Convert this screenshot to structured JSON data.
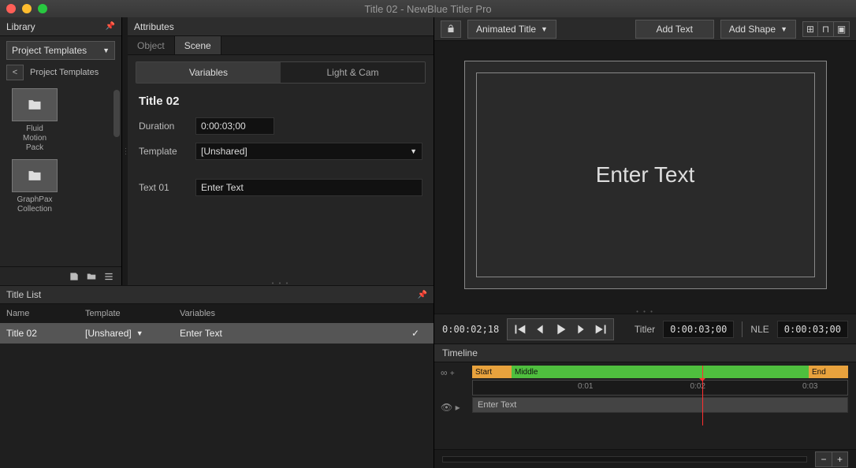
{
  "window": {
    "title": "Title 02 - NewBlue Titler Pro"
  },
  "library": {
    "header": "Library",
    "dropdown": "Project Templates",
    "breadcrumb": "Project Templates",
    "items": [
      {
        "label": "Fluid\nMotion\nPack"
      },
      {
        "label": "GraphPax\nCollection"
      }
    ]
  },
  "attributes": {
    "header": "Attributes",
    "tabs": {
      "object": "Object",
      "scene": "Scene"
    },
    "subtabs": {
      "variables": "Variables",
      "lightcam": "Light & Cam"
    },
    "title": "Title 02",
    "duration_label": "Duration",
    "duration_value": "0:00:03;00",
    "template_label": "Template",
    "template_value": "[Unshared]",
    "text01_label": "Text 01",
    "text01_value": "Enter Text"
  },
  "titlelist": {
    "header": "Title List",
    "cols": {
      "name": "Name",
      "template": "Template",
      "variables": "Variables"
    },
    "row": {
      "name": "Title 02",
      "template": "[Unshared]",
      "variables": "Enter Text"
    }
  },
  "toolbar": {
    "title_type": "Animated Title",
    "add_text": "Add Text",
    "add_shape": "Add Shape"
  },
  "preview": {
    "text": "Enter Text"
  },
  "transport": {
    "current": "0:00:02;18",
    "titler_label": "Titler",
    "titler_time": "0:00:03;00",
    "nle_label": "NLE",
    "nle_time": "0:00:03;00"
  },
  "timeline": {
    "header": "Timeline",
    "start": "Start",
    "middle": "Middle",
    "end": "End",
    "ticks": [
      "0:01",
      "0:02",
      "0:03"
    ],
    "track": "Enter Text"
  }
}
